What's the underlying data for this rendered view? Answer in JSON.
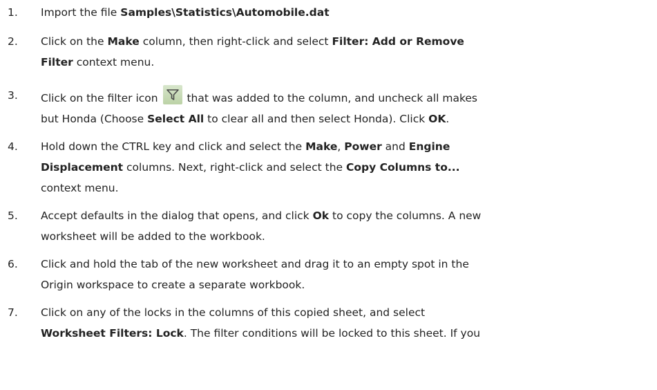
{
  "steps": [
    {
      "number": "1.",
      "lines": [
        [
          {
            "t": "Import the file "
          },
          {
            "b": "Samples\\Statistics\\Automobile.dat"
          }
        ]
      ]
    },
    {
      "number": "2.",
      "lines": [
        [
          {
            "t": "Click on the "
          },
          {
            "b": "Make"
          },
          {
            "t": " column, then right-click and select "
          },
          {
            "b": "Filter: Add or Remove"
          }
        ],
        [
          {
            "b": "Filter"
          },
          {
            "t": " context menu."
          }
        ]
      ]
    },
    {
      "number": "3.",
      "lines": [
        [
          {
            "t": "Click on the filter icon "
          },
          {
            "icon": "filter-icon"
          },
          {
            "t": " that was added to the column, and uncheck all makes"
          }
        ],
        [
          {
            "t": "but Honda (Choose "
          },
          {
            "b": "Select All"
          },
          {
            "t": " to clear all and then select Honda). Click "
          },
          {
            "b": "OK"
          },
          {
            "t": "."
          }
        ]
      ]
    },
    {
      "number": "4.",
      "lines": [
        [
          {
            "t": "Hold down the CTRL key and click and select the "
          },
          {
            "b": "Make"
          },
          {
            "t": ", "
          },
          {
            "b": "Power"
          },
          {
            "t": " and "
          },
          {
            "b": "Engine"
          }
        ],
        [
          {
            "b": "Displacement"
          },
          {
            "t": " columns. Next, right-click and select the "
          },
          {
            "b": "Copy Columns to..."
          }
        ],
        [
          {
            "t": "context menu."
          }
        ]
      ]
    },
    {
      "number": "5.",
      "lines": [
        [
          {
            "t": "Accept defaults in the dialog that opens, and click "
          },
          {
            "b": "Ok"
          },
          {
            "t": " to copy the columns. A new"
          }
        ],
        [
          {
            "t": "worksheet will be added to the workbook."
          }
        ]
      ]
    },
    {
      "number": "6.",
      "lines": [
        [
          {
            "t": "Click and hold the tab of the new worksheet and drag it to an empty spot in the"
          }
        ],
        [
          {
            "t": "Origin workspace to create a separate workbook."
          }
        ]
      ]
    },
    {
      "number": "7.",
      "lines": [
        [
          {
            "t": "Click on any of the locks in the columns of this copied sheet, and select"
          }
        ],
        [
          {
            "b": "Worksheet Filters: Lock"
          },
          {
            "t": ". The filter conditions will be locked to this sheet. If you"
          }
        ]
      ]
    }
  ]
}
